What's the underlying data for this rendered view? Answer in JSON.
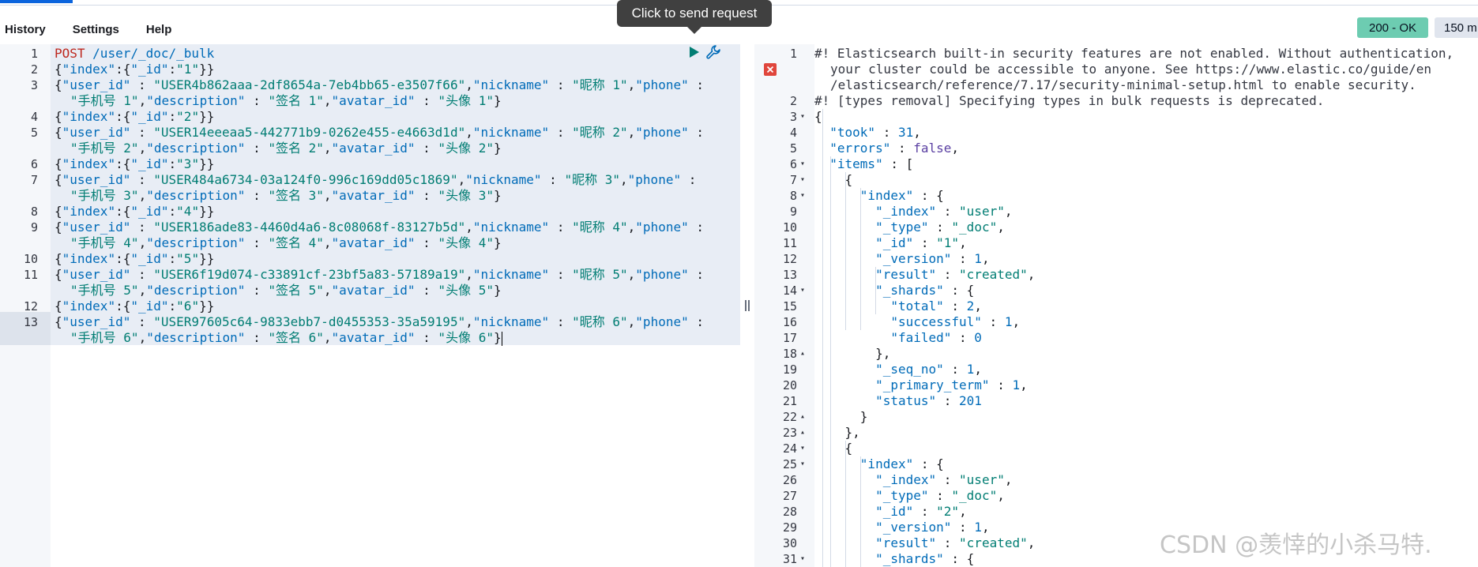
{
  "menu": {
    "items": [
      "History",
      "Settings",
      "Help"
    ]
  },
  "tooltip": {
    "text": "Click to send request"
  },
  "response_status": {
    "status": "200 - OK",
    "time": "150 m"
  },
  "icons": {
    "play": "play-icon",
    "wrench": "wrench-icon",
    "error": "error-icon",
    "resize": "resize-grip-icon"
  },
  "colors": {
    "status_badge": "#6dccb1",
    "error": "#e0463c",
    "keyword": "#bd271e",
    "string": "#017d73",
    "key": "#006bb8"
  },
  "request": {
    "method": "POST",
    "path": "/user/_doc/_bulk",
    "docs": [
      {
        "id": "1",
        "user_id": "USER4b862aaa-2df8654a-7eb4bb65-e3507f66",
        "nickname": "昵称 1",
        "phone": "手机号 1",
        "description": "签名 1",
        "avatar_id": "头像 1"
      },
      {
        "id": "2",
        "user_id": "USER14eeeaa5-442771b9-0262e455-e4663d1d",
        "nickname": "昵称 2",
        "phone": "手机号 2",
        "description": "签名 2",
        "avatar_id": "头像 2"
      },
      {
        "id": "3",
        "user_id": "USER484a6734-03a124f0-996c169dd05c1869",
        "nickname": "昵称 3",
        "phone": "手机号 3",
        "description": "签名 3",
        "avatar_id": "头像 3"
      },
      {
        "id": "4",
        "user_id": "USER186ade83-4460d4a6-8c08068f-83127b5d",
        "nickname": "昵称 4",
        "phone": "手机号 4",
        "description": "签名 4",
        "avatar_id": "头像 4"
      },
      {
        "id": "5",
        "user_id": "USER6f19d074-c33891cf-23bf5a83-57189a19",
        "nickname": "昵称 5",
        "phone": "手机号 5",
        "description": "签名 5",
        "avatar_id": "头像 5"
      },
      {
        "id": "6",
        "user_id": "USER97605c64-9833ebb7-d0455353-35a59195",
        "nickname": "昵称 6",
        "phone": "手机号 6",
        "description": "签名 6",
        "avatar_id": "头像 6"
      }
    ]
  },
  "response": {
    "warning_1_part1": "#! Elasticsearch built-in security features are not enabled. Without authentication,",
    "warning_1_part2": "your cluster could be accessible to anyone. See https://www.elastic.co/guide/en",
    "warning_1_part3": "/elasticsearch/reference/7.17/security-minimal-setup.html to enable security.",
    "warning_2": "#! [types removal] Specifying types in bulk requests is deprecated.",
    "took": "31",
    "errors": "false",
    "item1": {
      "_index": "user",
      "_type": "_doc",
      "_id": "1",
      "_version": "1",
      "result": "created",
      "total": "2",
      "successful": "1",
      "failed": "0",
      "_seq_no": "1",
      "_primary_term": "1",
      "status": "201"
    },
    "item2": {
      "_index": "user",
      "_type": "_doc",
      "_id": "2",
      "_version": "1",
      "result": "created"
    }
  },
  "watermark": "CSDN @羡悻的小杀马特."
}
